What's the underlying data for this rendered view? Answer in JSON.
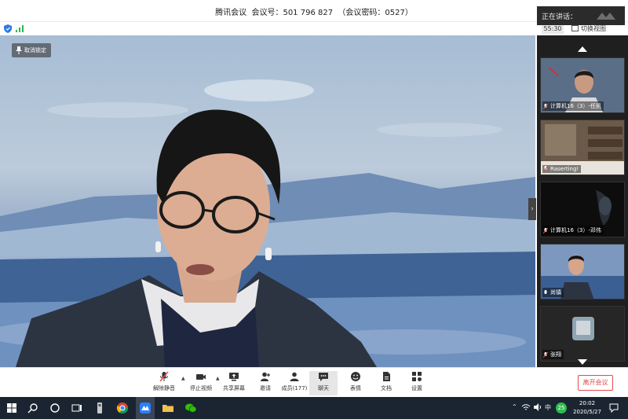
{
  "window": {
    "title": "腾讯会议  会议号：501 796 827  （会议密码：0527）",
    "speaking_label": "正在讲话："
  },
  "infobar": {
    "timer": "55:30",
    "switch_view": "切换视图"
  },
  "main": {
    "unpin_label": "取消锁定"
  },
  "participants": [
    {
      "name": "计算机16（3）-任凯"
    },
    {
      "name": "Raserting!"
    },
    {
      "name": "计算机16（3）-邓伟"
    },
    {
      "name": "尚镇"
    },
    {
      "name": "张翔"
    }
  ],
  "toolbar": {
    "unmute": "解除静音",
    "stop_video": "停止视频",
    "share_screen": "共享屏幕",
    "invite": "邀请",
    "members": "成员(177)",
    "chat": "聊天",
    "reactions": "表情",
    "docs": "文档",
    "settings": "设置",
    "leave": "离开会议"
  },
  "taskbar": {
    "ime": "中",
    "badge": "25",
    "time": "20:02",
    "date": "2020/5/27"
  },
  "colors": {
    "leave_red": "#e24b4b",
    "taskbar_bg": "#1b2532",
    "panel_bg": "#1f1f1f"
  }
}
